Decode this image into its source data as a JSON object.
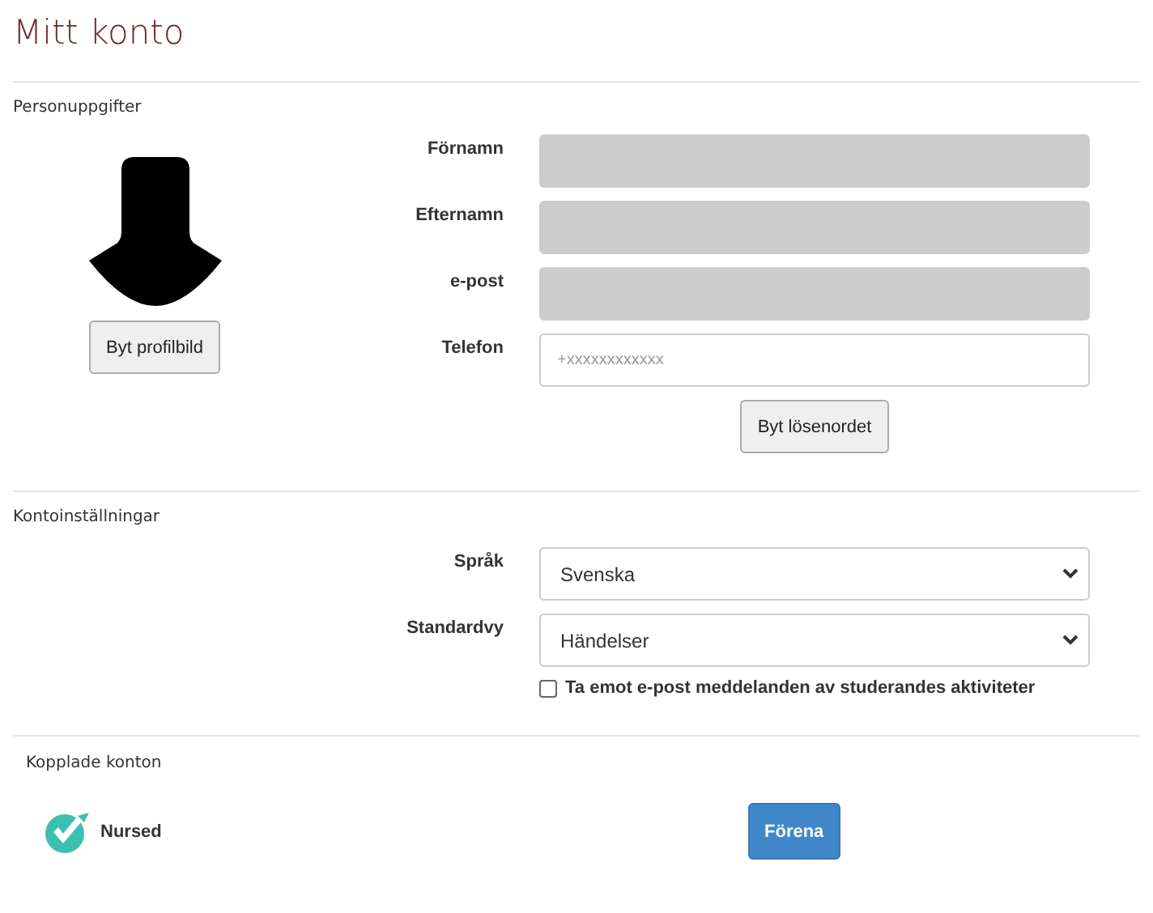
{
  "title": "Mitt konto",
  "personal": {
    "heading": "Personuppgifter",
    "avatar_button": "Byt profilbild",
    "fields": [
      {
        "label": "Förnamn",
        "disabled": true
      },
      {
        "label": "Efternamn",
        "disabled": true
      },
      {
        "label": "e-post",
        "disabled": true
      },
      {
        "label": "Telefon",
        "disabled": false,
        "placeholder": "+xxxxxxxxxxxx"
      }
    ],
    "password_button": "Byt lösenordet"
  },
  "settings": {
    "heading": "Kontoinställningar",
    "selects": [
      {
        "label": "Språk",
        "value": "Svenska"
      },
      {
        "label": "Standardvy",
        "value": "Händelser"
      }
    ],
    "checkbox": {
      "label": "Ta emot e-post meddelanden av studerandes aktiviteter",
      "checked": false
    }
  },
  "connected": {
    "heading": "Kopplade konton",
    "accounts": [
      {
        "name": "Nursed",
        "action": "Förena"
      }
    ]
  }
}
